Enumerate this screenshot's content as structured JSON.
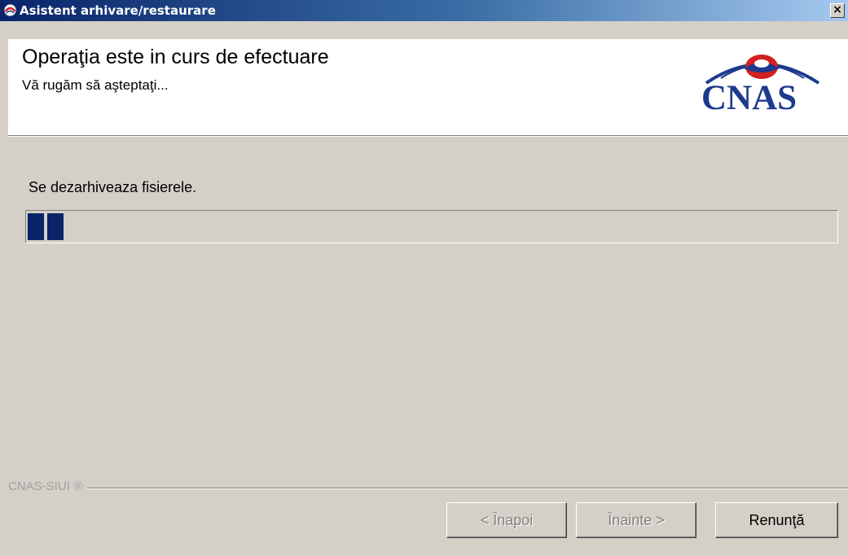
{
  "window": {
    "title": "Asistent arhivare/restaurare",
    "close_label": "×"
  },
  "header": {
    "title": "Operaţia este in curs de efectuare",
    "subtitle": "Vă rugăm să aşteptaţi...",
    "logo_text": "CNAS"
  },
  "body": {
    "status": "Se dezarhiveaza fisierele.",
    "progress_blocks": 2
  },
  "footer": {
    "brand": "CNAS-SIUI ®",
    "back_label": "< Înapoi",
    "next_label": "Înainte >",
    "cancel_label": "Renunţă"
  },
  "colors": {
    "titlebar_start": "#0a246a",
    "titlebar_end": "#a6caf0",
    "progress_fill": "#0a246a",
    "logo_blue": "#1e3a8e",
    "logo_red": "#d32020",
    "face": "#d4d0c8"
  },
  "icons": {
    "app": "cnas-app-icon",
    "close": "close-icon",
    "logo": "cnas-logo"
  }
}
